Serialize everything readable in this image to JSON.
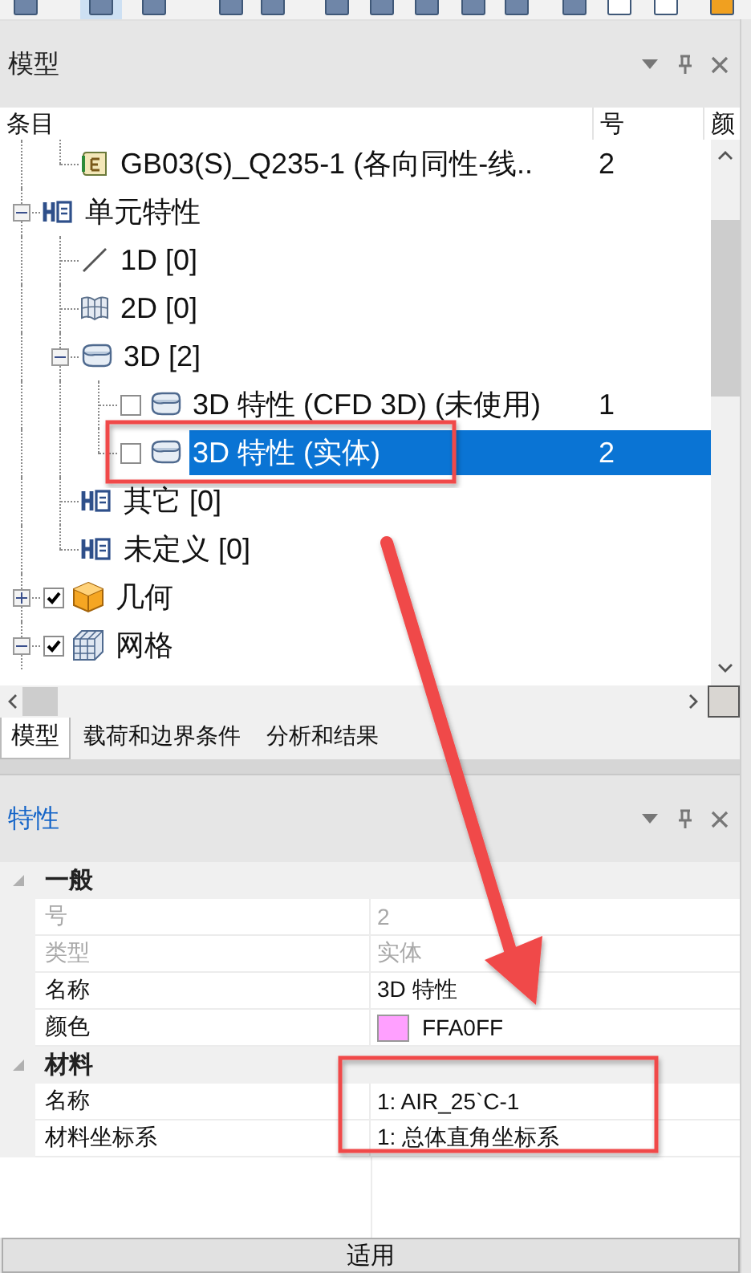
{
  "model_panel": {
    "title": "模型",
    "columns": [
      "条目",
      "号",
      "颜"
    ],
    "tree": [
      {
        "children": [
          {
            "label": "GB03(S)_Q235-1 (各向同性-线..",
            "number": "2",
            "kind": "material",
            "selected": false
          }
        ]
      },
      {
        "label": "单元特性",
        "kind": "folder",
        "expanded": true,
        "selected": false,
        "children": [
          {
            "label": "1D [0]",
            "kind": "line",
            "selected": false
          },
          {
            "label": "2D [0]",
            "kind": "surface",
            "selected": false
          },
          {
            "label": "3D [2]",
            "kind": "solid",
            "expanded": true,
            "selected": false,
            "children": [
              {
                "label": "3D 特性 (CFD 3D) (未使用)",
                "number": "1",
                "kind": "solid",
                "checked": false,
                "selected": false
              },
              {
                "label": "3D 特性 (实体)",
                "number": "2",
                "kind": "solid",
                "checked": false,
                "selected": true
              }
            ]
          },
          {
            "label": "其它 [0]",
            "kind": "folder",
            "selected": false
          },
          {
            "label": "未定义 [0]",
            "kind": "folder",
            "selected": false
          }
        ]
      },
      {
        "label": "几何",
        "kind": "geometry",
        "checked": true,
        "expanded": false,
        "selected": false
      },
      {
        "label": "网格",
        "kind": "mesh",
        "checked": true,
        "expanded": true,
        "selected": false
      }
    ],
    "tabs": [
      {
        "label": "模型",
        "selected": true
      },
      {
        "label": "载荷和边界条件",
        "selected": false
      },
      {
        "label": "分析和结果",
        "selected": false
      }
    ]
  },
  "properties_panel": {
    "title": "特性",
    "groups": [
      {
        "label": "一般",
        "expanded": true,
        "rows": [
          {
            "name": "号",
            "value": "2",
            "disabled": true
          },
          {
            "name": "类型",
            "value": "实体",
            "disabled": true
          },
          {
            "name": "名称",
            "value": "3D 特性",
            "disabled": false
          },
          {
            "name": "颜色",
            "value": "FFA0FF",
            "disabled": false,
            "color": "#ffa0ff"
          }
        ]
      },
      {
        "label": "材料",
        "expanded": true,
        "rows": [
          {
            "name": "名称",
            "value": "1: AIR_25`C-1",
            "disabled": false
          },
          {
            "name": "材料坐标系",
            "value": "1: 总体直角坐标系",
            "disabled": false
          }
        ]
      }
    ],
    "apply_button": "适用"
  }
}
